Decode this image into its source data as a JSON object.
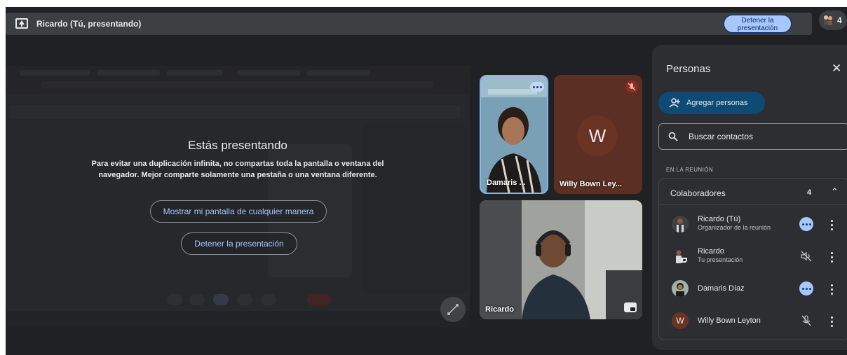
{
  "topbar": {
    "presenter_title": "Ricardo (Tú, presentando)",
    "stop_button_label": "Detener la presentación",
    "participant_count": "4"
  },
  "presentation": {
    "heading": "Estás presentando",
    "warning": "Para evitar una duplicación infinita, no compartas toda la pantalla o ventana del navegador. Mejor comparte solamente una pestaña o una ventana diferente.",
    "show_anyway_label": "Mostrar mi pantalla de cualquier manera",
    "stop_label": "Detener la presentación"
  },
  "tiles": {
    "damaris": {
      "name": "Damaris ..."
    },
    "willy": {
      "name": "Willy Bown Ley...",
      "avatar_letter": "W"
    },
    "ricardo": {
      "name": "Ricardo"
    }
  },
  "people_panel": {
    "title": "Personas",
    "add_people_label": "Agregar personas",
    "search_placeholder": "Buscar contactos",
    "section_label": "EN LA REUNIÓN",
    "group_label": "Colaboradores",
    "group_count": "4",
    "participants": [
      {
        "name": "Ricardo (Tú)",
        "subtitle": "Organizador de la reunión",
        "status": "more-options"
      },
      {
        "name": "Ricardo",
        "subtitle": "Tu presentación",
        "status": "muted-presentation"
      },
      {
        "name": "Damaris Díaz",
        "subtitle": "",
        "status": "more-options"
      },
      {
        "name": "Willy Bown Leyton",
        "subtitle": "",
        "status": "muted",
        "avatar_letter": "W"
      }
    ]
  },
  "colors": {
    "background": "#202124",
    "accent": "#a8c7fa",
    "add_button": "#0d4b75",
    "mute_red": "#8c2c21"
  }
}
